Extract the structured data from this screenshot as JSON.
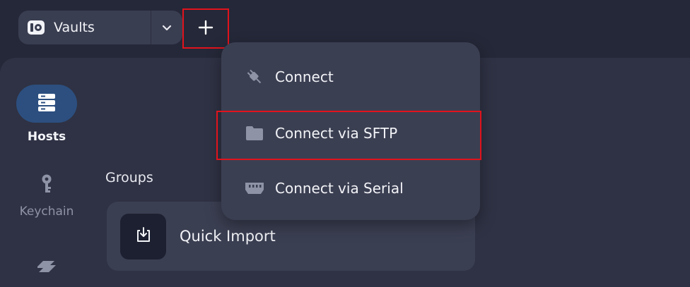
{
  "topbar": {
    "vaults_label": "Vaults",
    "vault_logo_icon": "vault-logo-icon",
    "chevron_icon": "chevron-down-icon",
    "add_icon": "plus-icon"
  },
  "sidebar": {
    "items": [
      {
        "label": "Hosts",
        "icon": "server-icon",
        "active": true
      },
      {
        "label": "Keychain",
        "icon": "key-icon",
        "active": false
      },
      {
        "label": "",
        "icon": "port-forwarding-icon",
        "active": false
      }
    ]
  },
  "main": {
    "groups_label": "Groups",
    "quick_import_label": "Quick Import",
    "quick_import_icon": "import-icon"
  },
  "dropdown": {
    "items": [
      {
        "label": "Connect",
        "icon": "plug-icon"
      },
      {
        "label": "Connect via SFTP",
        "icon": "folder-icon"
      },
      {
        "label": "Connect via Serial",
        "icon": "serial-port-icon"
      }
    ]
  },
  "colors": {
    "background": "#252838",
    "panel": "#2f3244",
    "card": "#3b3f52",
    "accent_active": "#2c4f7f",
    "highlight_border": "#e1131c"
  }
}
